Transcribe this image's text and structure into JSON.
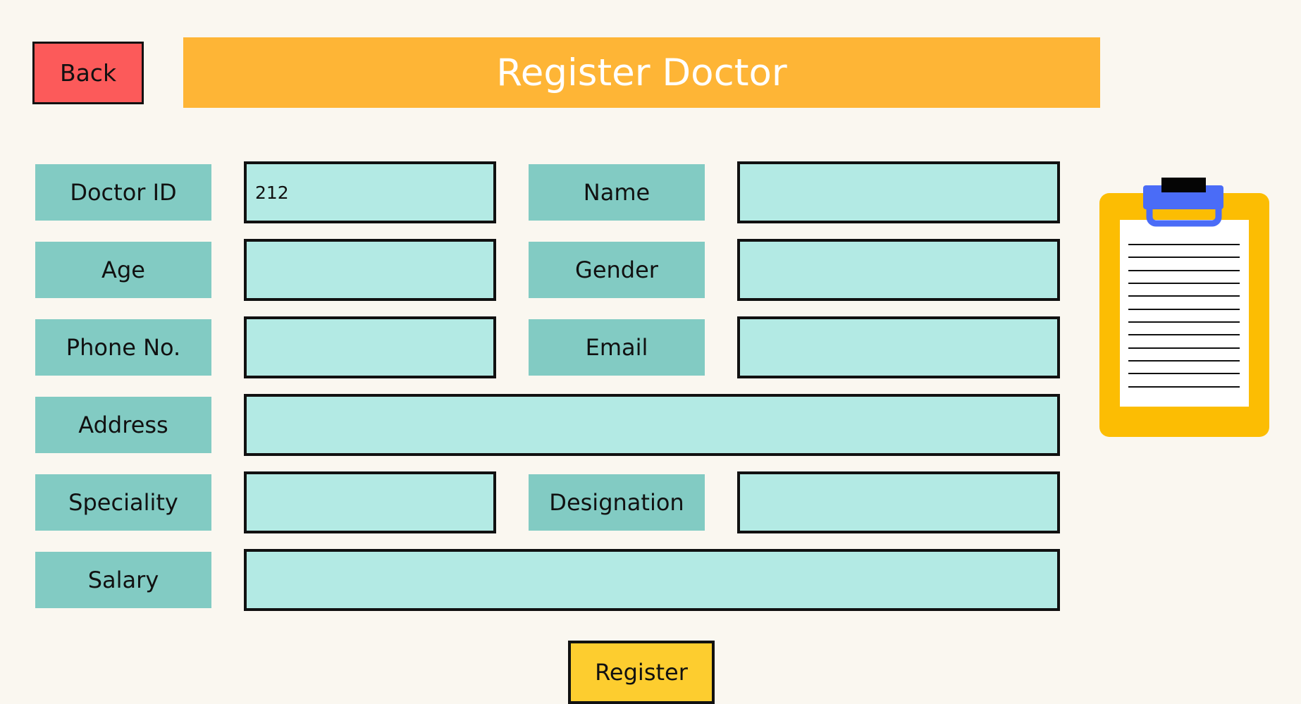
{
  "header": {
    "back_label": "Back",
    "title": "Register Doctor"
  },
  "form": {
    "doctor_id": {
      "label": "Doctor ID",
      "value": "212"
    },
    "name": {
      "label": "Name",
      "value": ""
    },
    "age": {
      "label": "Age",
      "value": ""
    },
    "gender": {
      "label": "Gender",
      "value": ""
    },
    "phone": {
      "label": "Phone No.",
      "value": ""
    },
    "email": {
      "label": "Email",
      "value": ""
    },
    "address": {
      "label": "Address",
      "value": ""
    },
    "speciality": {
      "label": "Speciality",
      "value": ""
    },
    "designation": {
      "label": "Designation",
      "value": ""
    },
    "salary": {
      "label": "Salary",
      "value": ""
    }
  },
  "actions": {
    "register_label": "Register"
  },
  "decor": {
    "clipboard_icon": "clipboard-icon"
  },
  "colors": {
    "background": "#faf7f0",
    "back_button": "#fc5a5a",
    "title_banner": "#feb536",
    "label_bg": "#82cbc3",
    "field_bg": "#b3eae4",
    "register_button": "#fdcd2f"
  }
}
